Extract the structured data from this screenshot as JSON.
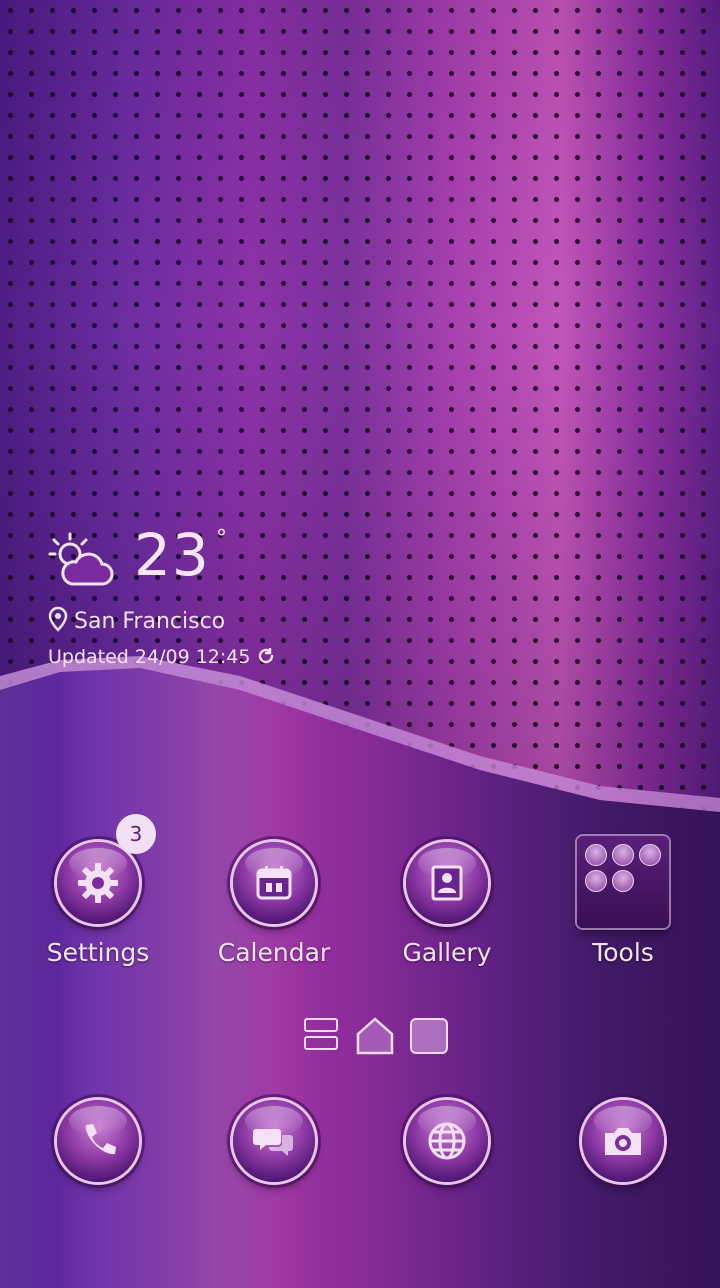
{
  "weather": {
    "temperature": "23",
    "degree_symbol": "°",
    "location": "San Francisco",
    "updated": "Updated 24/09 12:45",
    "icon": "partly-cloudy-icon"
  },
  "apps": [
    {
      "label": "Settings",
      "icon": "gear-icon",
      "badge": "3"
    },
    {
      "label": "Calendar",
      "icon": "calendar-icon"
    },
    {
      "label": "Gallery",
      "icon": "contact-photo-icon"
    },
    {
      "label": "Tools",
      "icon": "folder-icon"
    }
  ],
  "dock": [
    {
      "icon": "phone-icon"
    },
    {
      "icon": "messages-icon"
    },
    {
      "icon": "browser-globe-icon"
    },
    {
      "icon": "camera-icon"
    }
  ],
  "pager": {
    "current": 2,
    "total": 3
  },
  "colors": {
    "accent": "#f1dff3",
    "wallpaper": "#8a2fa6"
  }
}
